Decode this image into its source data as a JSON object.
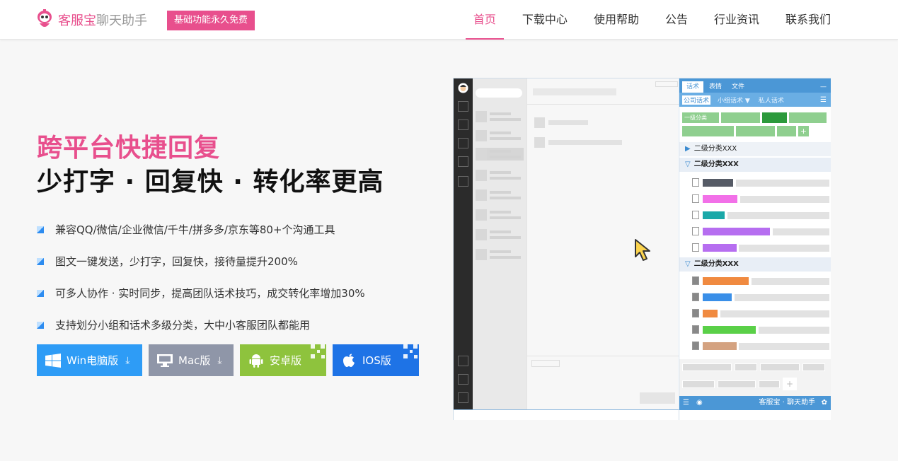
{
  "header": {
    "brand": "客服宝",
    "brand_sub": "聊天助手",
    "badge": "基础功能永久免费",
    "nav": [
      "首页",
      "下载中心",
      "使用帮助",
      "公告",
      "行业资讯",
      "联系我们"
    ],
    "active_nav": "首页"
  },
  "hero": {
    "title1": "跨平台快捷回复",
    "title2": "少打字 · 回复快 · 转化率更高",
    "features": [
      "兼容QQ/微信/企业微信/千牛/拼多多/京东等80+个沟通工具",
      "图文一键发送，少打字，回复快，接待量提升200%",
      "可多人协作 · 实时同步，提高团队话术技巧，成交转化率增加30%",
      "支持划分小组和话术多级分类，大中小客服团队都能用"
    ]
  },
  "downloads": {
    "win": "Win电脑版",
    "mac": "Mac版",
    "android": "安卓版",
    "ios": "IOS版",
    "download_glyph": "⤓"
  },
  "mockup": {
    "tabs": [
      "话术",
      "表情",
      "文件"
    ],
    "subtabs": [
      "公司话术",
      "小组话术 ▼",
      "私人话术"
    ],
    "category_first": "一级分类",
    "plus": "+",
    "minus": "—",
    "group1": "二级分类XXX",
    "group2": "二级分类XXX",
    "group3": "二级分类XXX",
    "footer_brand": "客服宝 · 聊天助手",
    "colors": {
      "text_bars": [
        "#565b66",
        "#f270e8",
        "#1aa8a8",
        "#b66ef0",
        "#b66ef0"
      ],
      "image_bars": [
        "#f08a40",
        "#3a8fe8",
        "#f08a40",
        "#5ad048",
        "#d4a280"
      ]
    }
  }
}
